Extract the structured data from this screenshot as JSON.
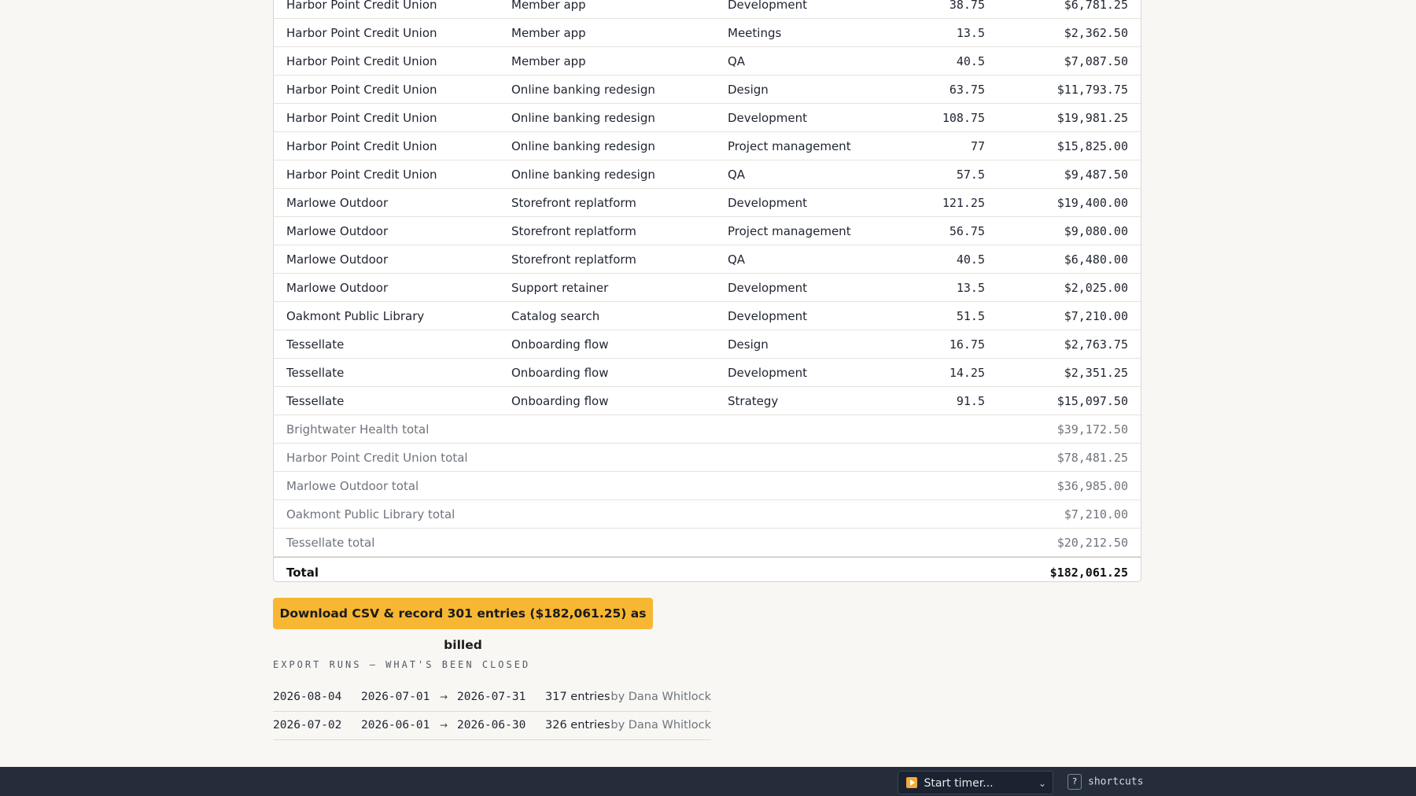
{
  "report": {
    "rows": [
      {
        "client": "Harbor Point Credit Union",
        "project": "Member app",
        "task": "Development",
        "hours": "38.75",
        "amount": "$6,781.25"
      },
      {
        "client": "Harbor Point Credit Union",
        "project": "Member app",
        "task": "Meetings",
        "hours": "13.5",
        "amount": "$2,362.50"
      },
      {
        "client": "Harbor Point Credit Union",
        "project": "Member app",
        "task": "QA",
        "hours": "40.5",
        "amount": "$7,087.50"
      },
      {
        "client": "Harbor Point Credit Union",
        "project": "Online banking redesign",
        "task": "Design",
        "hours": "63.75",
        "amount": "$11,793.75"
      },
      {
        "client": "Harbor Point Credit Union",
        "project": "Online banking redesign",
        "task": "Development",
        "hours": "108.75",
        "amount": "$19,981.25"
      },
      {
        "client": "Harbor Point Credit Union",
        "project": "Online banking redesign",
        "task": "Project management",
        "hours": "77",
        "amount": "$15,825.00"
      },
      {
        "client": "Harbor Point Credit Union",
        "project": "Online banking redesign",
        "task": "QA",
        "hours": "57.5",
        "amount": "$9,487.50"
      },
      {
        "client": "Marlowe Outdoor",
        "project": "Storefront replatform",
        "task": "Development",
        "hours": "121.25",
        "amount": "$19,400.00"
      },
      {
        "client": "Marlowe Outdoor",
        "project": "Storefront replatform",
        "task": "Project management",
        "hours": "56.75",
        "amount": "$9,080.00"
      },
      {
        "client": "Marlowe Outdoor",
        "project": "Storefront replatform",
        "task": "QA",
        "hours": "40.5",
        "amount": "$6,480.00"
      },
      {
        "client": "Marlowe Outdoor",
        "project": "Support retainer",
        "task": "Development",
        "hours": "13.5",
        "amount": "$2,025.00"
      },
      {
        "client": "Oakmont Public Library",
        "project": "Catalog search",
        "task": "Development",
        "hours": "51.5",
        "amount": "$7,210.00"
      },
      {
        "client": "Tessellate",
        "project": "Onboarding flow",
        "task": "Design",
        "hours": "16.75",
        "amount": "$2,763.75"
      },
      {
        "client": "Tessellate",
        "project": "Onboarding flow",
        "task": "Development",
        "hours": "14.25",
        "amount": "$2,351.25"
      },
      {
        "client": "Tessellate",
        "project": "Onboarding flow",
        "task": "Strategy",
        "hours": "91.5",
        "amount": "$15,097.50"
      }
    ],
    "subtotals": [
      {
        "label": "Brightwater Health total",
        "amount": "$39,172.50"
      },
      {
        "label": "Harbor Point Credit Union total",
        "amount": "$78,481.25"
      },
      {
        "label": "Marlowe Outdoor total",
        "amount": "$36,985.00"
      },
      {
        "label": "Oakmont Public Library total",
        "amount": "$7,210.00"
      },
      {
        "label": "Tessellate total",
        "amount": "$20,212.50"
      }
    ],
    "grand_total": {
      "label": "Total",
      "amount": "$182,061.25"
    }
  },
  "export_button": {
    "label": "Download CSV & record 301 entries ($182,061.25) as billed"
  },
  "export_runs": {
    "heading": "EXPORT RUNS — WHAT'S BEEN CLOSED",
    "arrow": "→",
    "items": [
      {
        "date": "2026-08-04",
        "from": "2026-07-01",
        "to": "2026-07-31",
        "count": "317 entries",
        "by": "by Dana Whitlock"
      },
      {
        "date": "2026-07-02",
        "from": "2026-06-01",
        "to": "2026-06-30",
        "count": "326 entries",
        "by": "by Dana Whitlock"
      }
    ]
  },
  "bottombar": {
    "timer_label": "Start timer...",
    "timer_icon": "play-icon",
    "shortcut_key": "?",
    "shortcuts_label": "shortcuts"
  }
}
